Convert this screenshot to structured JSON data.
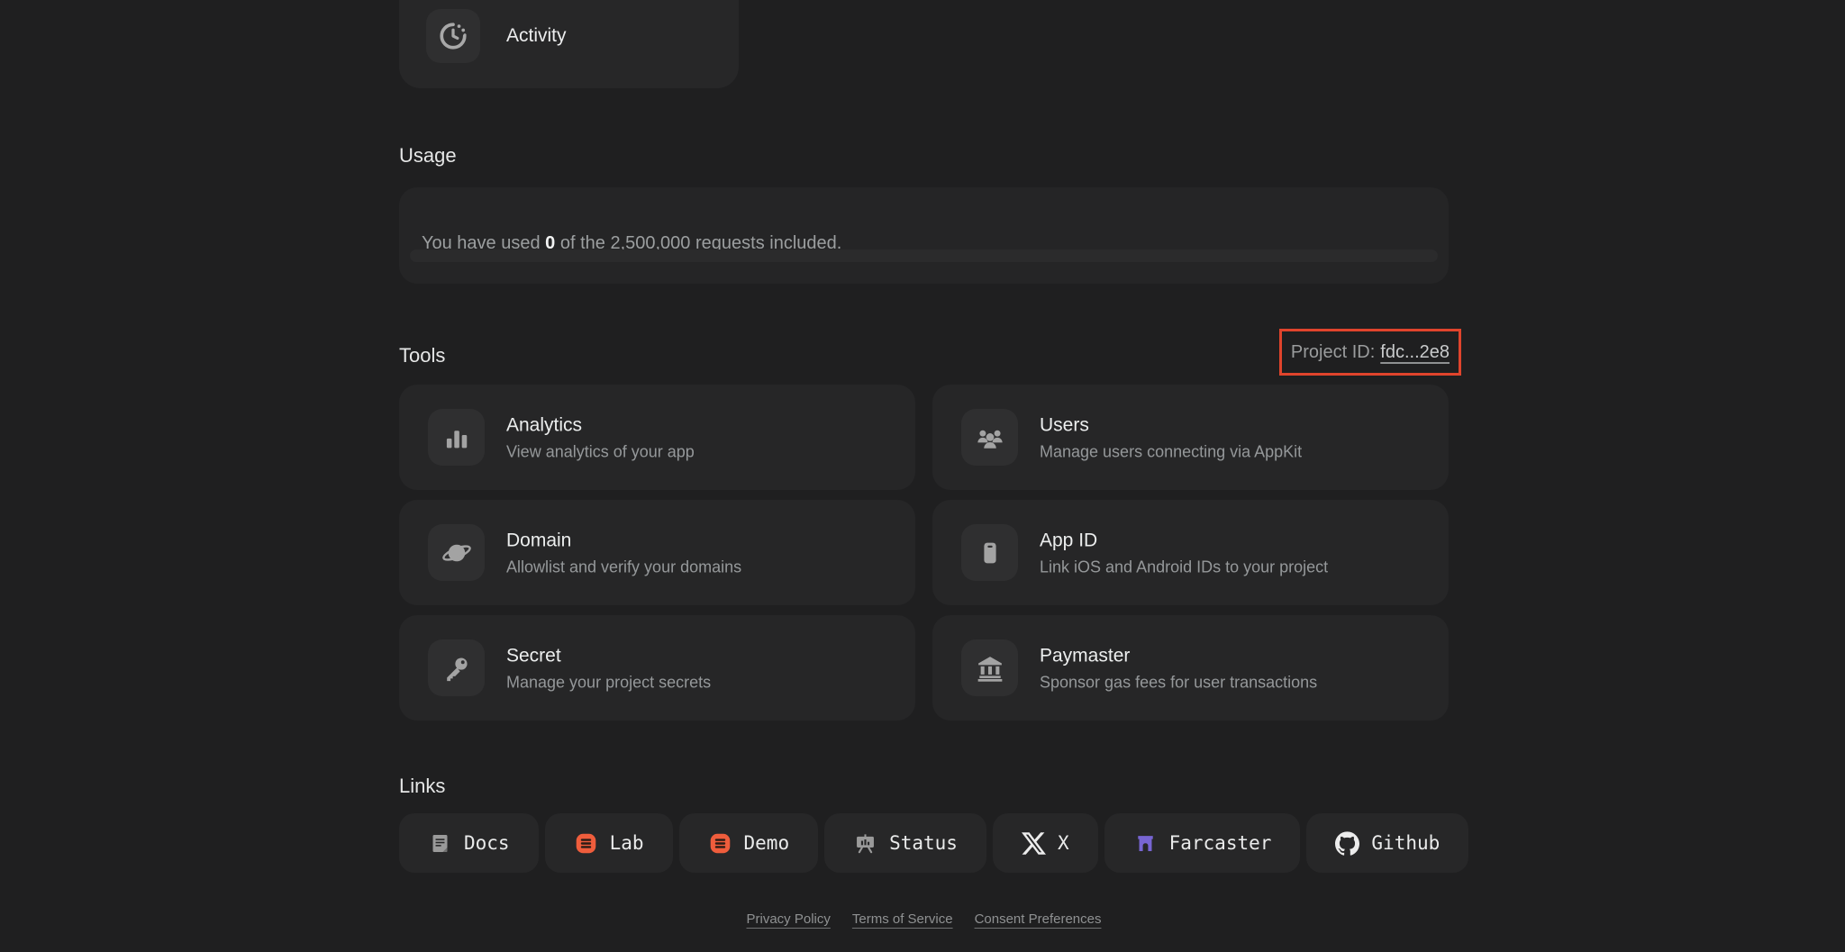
{
  "activity": {
    "label": "Activity",
    "icon": "clock"
  },
  "usage": {
    "heading": "Usage",
    "message_prefix": "You have used",
    "used_count": "0",
    "message_suffix": "of the 2,500,000 requests included.",
    "progress_percent": 0
  },
  "tools": {
    "heading": "Tools",
    "project_id": {
      "label": "Project ID:",
      "value": "fdc...2e8"
    },
    "cards": [
      {
        "title": "Analytics",
        "description": "View analytics of your app",
        "icon": "bar-chart"
      },
      {
        "title": "Users",
        "description": "Manage users connecting via AppKit",
        "icon": "users"
      },
      {
        "title": "Domain",
        "description": "Allowlist and verify your domains",
        "icon": "planet"
      },
      {
        "title": "App ID",
        "description": "Link iOS and Android IDs to your project",
        "icon": "phone"
      },
      {
        "title": "Secret",
        "description": "Manage your project secrets",
        "icon": "key"
      },
      {
        "title": "Paymaster",
        "description": "Sponsor gas fees for user transactions",
        "icon": "bank"
      }
    ]
  },
  "links": {
    "heading": "Links",
    "buttons": [
      {
        "label": "Docs",
        "icon": "document"
      },
      {
        "label": "Lab",
        "icon": "reown-logo"
      },
      {
        "label": "Demo",
        "icon": "reown-logo"
      },
      {
        "label": "Status",
        "icon": "presentation"
      },
      {
        "label": "X",
        "icon": "x-logo"
      },
      {
        "label": "Farcaster",
        "icon": "farcaster-logo"
      },
      {
        "label": "Github",
        "icon": "github-logo"
      }
    ]
  },
  "footer": {
    "links": [
      "Privacy Policy",
      "Terms of Service",
      "Consent Preferences"
    ]
  },
  "colors": {
    "page_bg": "#1f1f20",
    "card_bg": "#262627",
    "tile_bg": "#2f2f30",
    "icon_gray": "#a3a3a3",
    "text_primary": "#eceeee",
    "text_secondary": "#95989a",
    "annotation_red": "#e0442c",
    "reown_orange": "#ef5d3c",
    "farcaster_purple": "#7765d2"
  }
}
